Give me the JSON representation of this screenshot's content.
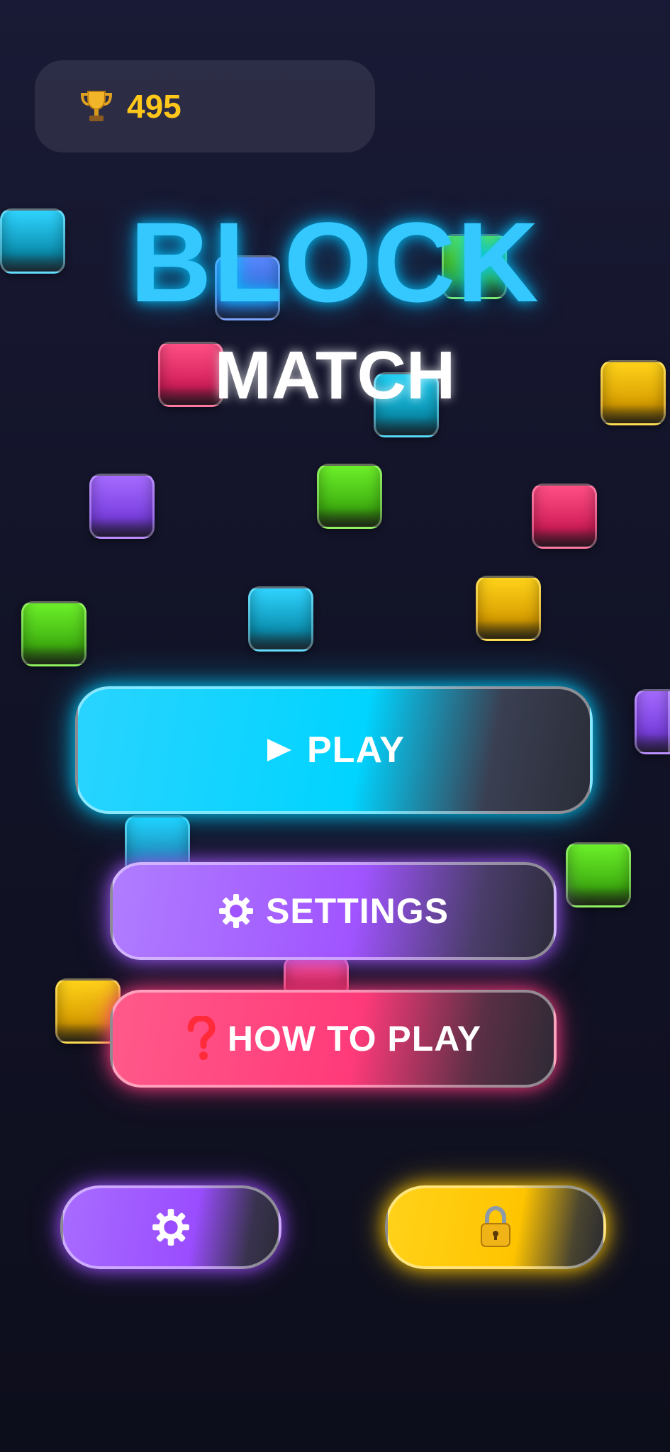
{
  "score": {
    "icon": "trophy-icon",
    "value": "495",
    "color": "#ffc81a"
  },
  "title": {
    "line1": "BLOCK",
    "line2": "MATCH",
    "line1_color": "#35c8ff",
    "line2_color": "#ffffff"
  },
  "menu": {
    "play": {
      "icon": "play-icon",
      "label": "PLAY",
      "color": "#00d4ff"
    },
    "settings": {
      "icon": "gear-icon",
      "label": "SETTINGS",
      "color": "#a054ff"
    },
    "how_to_play": {
      "icon": "question-mark-icon",
      "label": "HOW TO PLAY",
      "color": "#ff3a7a"
    }
  },
  "bottom_buttons": {
    "gear": {
      "icon": "gear-icon",
      "color": "#9a4dff"
    },
    "lock": {
      "icon": "lock-icon",
      "color": "#ffc400"
    }
  },
  "block_colors": {
    "cyan": "#18c8f0",
    "pink": "#ff3a74",
    "yellow": "#ffc400",
    "purple": "#9a55ff",
    "green": "#5ee01a",
    "blue": "#4f7dff"
  }
}
